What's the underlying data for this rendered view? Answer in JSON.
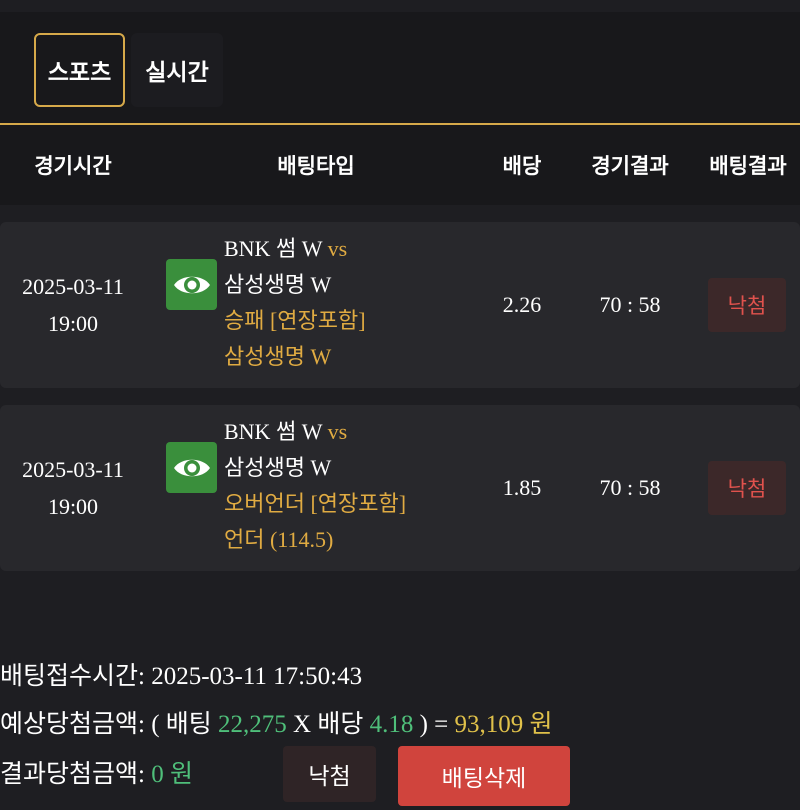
{
  "tabs": {
    "sports": "스포츠",
    "live": "실시간"
  },
  "headers": {
    "time": "경기시간",
    "bet_type": "배팅타입",
    "odds": "배당",
    "game_result": "경기결과",
    "bet_result": "배팅결과"
  },
  "bets": [
    {
      "date": "2025-03-11",
      "time": "19:00",
      "home": "BNK 썸 W",
      "vs": "vs",
      "away": "삼성생명 W",
      "market": "승패 [연장포함]",
      "pick": "삼성생명 W",
      "odds": "2.26",
      "score": "70 : 58",
      "status": "낙첨"
    },
    {
      "date": "2025-03-11",
      "time": "19:00",
      "home": "BNK 썸 W",
      "vs": "vs",
      "away": "삼성생명 W",
      "market": "오버언더 [연장포함]",
      "pick": "언더 (114.5)",
      "odds": "1.85",
      "score": "70 : 58",
      "status": "낙첨"
    }
  ],
  "summary": {
    "received_label": "배팅접수시간:",
    "received_value": "2025-03-11 17:50:43",
    "expected_label": "예상당첨금액:",
    "open_paren": "( 배팅",
    "bet_amount": "22,275",
    "times_label": "X 배당",
    "total_odds": "4.18",
    "close_eq": ") =",
    "expected_amount": "93,109",
    "currency": "원",
    "result_label": "결과당첨금액:",
    "result_amount": "0",
    "result_currency": "원"
  },
  "buttons": {
    "lost": "낙첨",
    "delete": "배팅삭제"
  },
  "colors": {
    "accent_gold": "#d6a94a",
    "lost_red": "#e0524d",
    "delete_red": "#d0443d",
    "eye_green": "#3a8f3c",
    "amount_green": "#4fbf7a",
    "amount_yellow": "#e0c14a"
  },
  "icons": {
    "view": "eye-icon"
  }
}
